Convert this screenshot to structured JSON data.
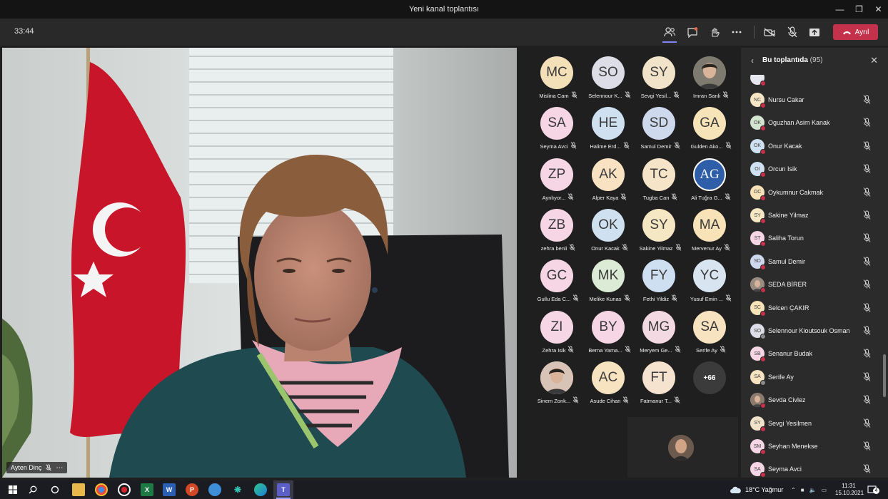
{
  "window": {
    "title": "Yeni kanal toplantısı"
  },
  "toolbar": {
    "timer": "33:44",
    "leave_label": "Ayrıl",
    "leave_color": "#c4314b"
  },
  "main_video": {
    "name": "Ayten Dinç"
  },
  "gallery": {
    "tiles": [
      {
        "initials": "MC",
        "name": "Mislina Cam",
        "color": "#f4e0b8"
      },
      {
        "initials": "SO",
        "name": "Selennour K...",
        "color": "#dcdde6"
      },
      {
        "initials": "SY",
        "name": "Sevgi Yesil...",
        "color": "#f1e3c9"
      },
      {
        "initials": "",
        "name": "Imran Sanli",
        "color": "#7f7a70"
      },
      {
        "initials": "SA",
        "name": "Seyma Avci",
        "color": "#f6d6e4"
      },
      {
        "initials": "HE",
        "name": "Halime Erd...",
        "color": "#cfe0f0"
      },
      {
        "initials": "SD",
        "name": "Samul Demir",
        "color": "#cfd9ee"
      },
      {
        "initials": "GA",
        "name": "Gulden Ako...",
        "color": "#f7e3b8"
      },
      {
        "initials": "ZP",
        "name": "Aynlıyor...",
        "color": "#f6d6e4"
      },
      {
        "initials": "AK",
        "name": "Alper Kaya",
        "color": "#f8e2c2"
      },
      {
        "initials": "TC",
        "name": "Tugba Can",
        "color": "#f5e4c8"
      },
      {
        "initials": "AG",
        "name": "Ali Tuğra G...",
        "color": "#2e5ea8"
      },
      {
        "initials": "ZB",
        "name": "zehra benli",
        "color": "#f6d6e4"
      },
      {
        "initials": "OK",
        "name": "Onur Kacak",
        "color": "#cfe0f0"
      },
      {
        "initials": "SY",
        "name": "Sakine Yilmaz",
        "color": "#f5e6c4"
      },
      {
        "initials": "MA",
        "name": "Mervenur Ay",
        "color": "#f8e2b8"
      },
      {
        "initials": "GC",
        "name": "Gullu Eda C...",
        "color": "#f6d6e4"
      },
      {
        "initials": "MK",
        "name": "Melike Kunas",
        "color": "#dcebd6"
      },
      {
        "initials": "FY",
        "name": "Fethi Yildiz",
        "color": "#cfdff2"
      },
      {
        "initials": "YC",
        "name": "Yusuf Emin ...",
        "color": "#d8e4ef"
      },
      {
        "initials": "ZI",
        "name": "Zehra Isik",
        "color": "#f6d6e4"
      },
      {
        "initials": "BY",
        "name": "Berna Yama...",
        "color": "#f6d6e4"
      },
      {
        "initials": "MG",
        "name": "Meryem Ge...",
        "color": "#f3d9e2"
      },
      {
        "initials": "SA",
        "name": "Serife Ay",
        "color": "#f7e3c0"
      },
      {
        "initials": "",
        "name": "Sinem Zonk...",
        "color": "#d8c4b6"
      },
      {
        "initials": "AC",
        "name": "Asude Cihan",
        "color": "#f7e3c0"
      },
      {
        "initials": "FT",
        "name": "Fatmanur T...",
        "color": "#f6e3cf"
      }
    ],
    "more_label": "+66"
  },
  "panel": {
    "title": "Bu toplantıda",
    "count": "(95)",
    "participants": [
      {
        "initials": "NC",
        "name": "Nursu Cakar",
        "color": "#f6e6c6",
        "status": "busy"
      },
      {
        "initials": "OK",
        "name": "Oguzhan Asim Kanak",
        "color": "#d3e4cf",
        "status": "busy"
      },
      {
        "initials": "OK",
        "name": "Onur Kacak",
        "color": "#cfe0f0",
        "status": "busy"
      },
      {
        "initials": "OI",
        "name": "Orcun Isik",
        "color": "#cfe0f0",
        "status": "busy"
      },
      {
        "initials": "OC",
        "name": "Oykumnur Cakmak",
        "color": "#f7e2b8",
        "status": "busy"
      },
      {
        "initials": "SY",
        "name": "Sakine Yilmaz",
        "color": "#f5e6c4",
        "status": "busy"
      },
      {
        "initials": "ST",
        "name": "Saliha Torun",
        "color": "#f6d6e4",
        "status": "busy"
      },
      {
        "initials": "SD",
        "name": "Samul Demir",
        "color": "#cfd9ee",
        "status": "busy"
      },
      {
        "initials": "",
        "name": "SEDA BİRER",
        "color": "#9a8b80",
        "status": "busy"
      },
      {
        "initials": "SC",
        "name": "Selcen ÇAKIR",
        "color": "#f7e3b8",
        "status": "busy"
      },
      {
        "initials": "SO",
        "name": "Selennour Kioutsouk Osman",
        "color": "#dcdde6",
        "status": "idle"
      },
      {
        "initials": "SB",
        "name": "Senanur Budak",
        "color": "#f6d6e4",
        "status": "busy"
      },
      {
        "initials": "SA",
        "name": "Serife Ay",
        "color": "#f7e3c0",
        "status": "idle"
      },
      {
        "initials": "",
        "name": "Sevda Civlez",
        "color": "#8d7a6e",
        "status": "busy"
      },
      {
        "initials": "SY",
        "name": "Sevgi Yesilmen",
        "color": "#f1e3c9",
        "status": "busy"
      },
      {
        "initials": "SM",
        "name": "Seyhan Menekse",
        "color": "#f6d6e4",
        "status": "busy"
      },
      {
        "initials": "SA",
        "name": "Seyma Avci",
        "color": "#f6d6e4",
        "status": "busy"
      }
    ]
  },
  "taskbar": {
    "weather": "18°C  Yağmur",
    "time": "11:31",
    "date": "15.10.2021",
    "notification_count": "4"
  }
}
